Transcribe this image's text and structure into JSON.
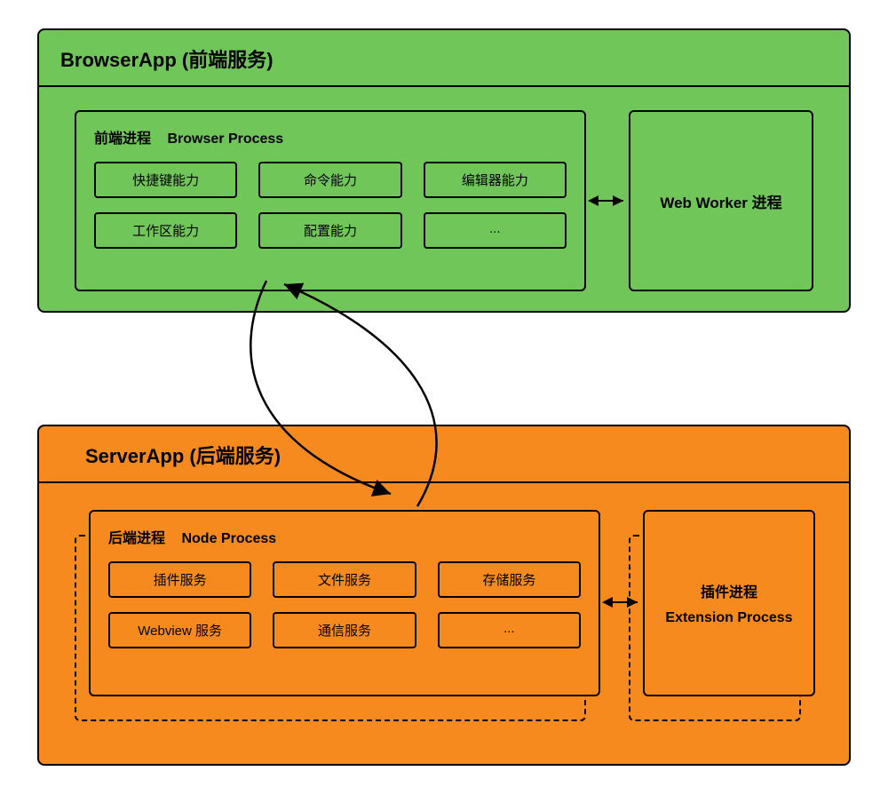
{
  "browser_app": {
    "title": "BrowserApp (前端服务)",
    "process": {
      "zh": "前端进程",
      "en": "Browser Process",
      "caps": [
        "快捷键能力",
        "命令能力",
        "编辑器能力",
        "工作区能力",
        "配置能力",
        "..."
      ]
    },
    "webworker": "Web Worker 进程"
  },
  "server_app": {
    "title": "ServerApp (后端服务)",
    "process": {
      "zh": "后端进程",
      "en": "Node Process",
      "caps": [
        "插件服务",
        "文件服务",
        "存储服务",
        "Webview 服务",
        "通信服务",
        "..."
      ]
    },
    "extension": {
      "line1": "插件进程",
      "line2": "Extension Process"
    }
  }
}
